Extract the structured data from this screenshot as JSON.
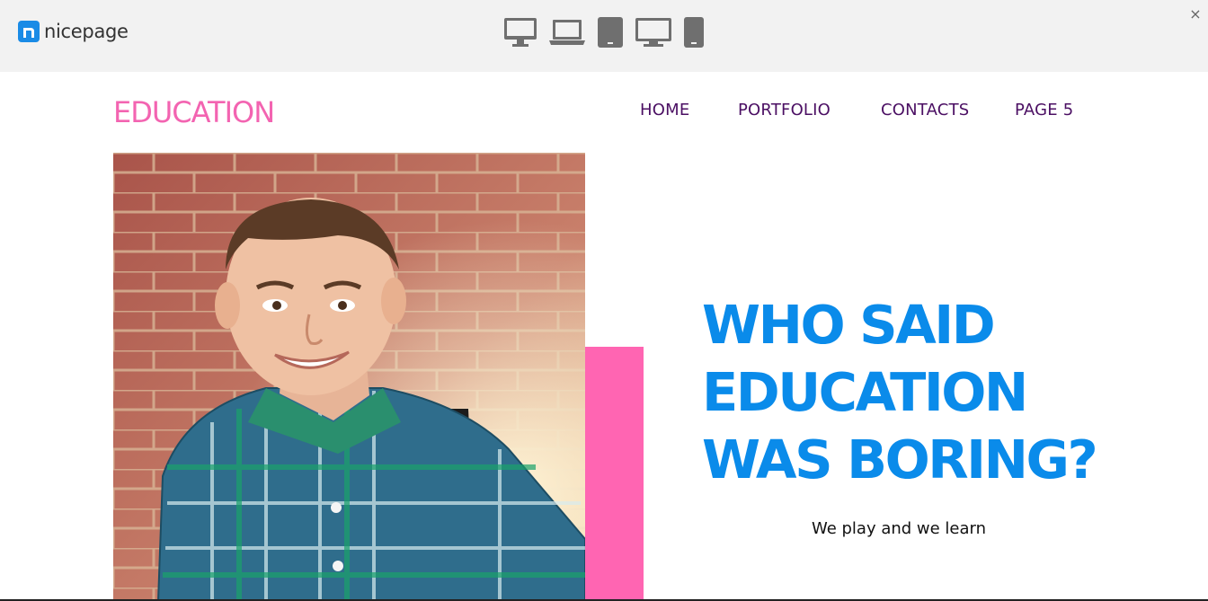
{
  "toolbar": {
    "brand_name": "nicepage",
    "devices": [
      "desktop-large",
      "laptop",
      "tablet",
      "desktop",
      "phone"
    ],
    "close_label": "×"
  },
  "site": {
    "title": "EDUCATION"
  },
  "nav": {
    "items": [
      "HOME",
      "PORTFOLIO",
      "CONTACTS",
      "PAGE 5"
    ]
  },
  "hero": {
    "headline": [
      "WHO SAID",
      "EDUCATION",
      "WAS BORING?"
    ],
    "subtitle": "We play and we learn"
  },
  "colors": {
    "brand_blue": "#1a8be6",
    "title_pink": "#f364b1",
    "accent_pink": "#ff65b2",
    "nav_purple": "#4b0f63",
    "headline_blue": "#0a8bea",
    "toolbar_bg": "#f2f2f2",
    "device_icon": "#6f6f6f"
  }
}
